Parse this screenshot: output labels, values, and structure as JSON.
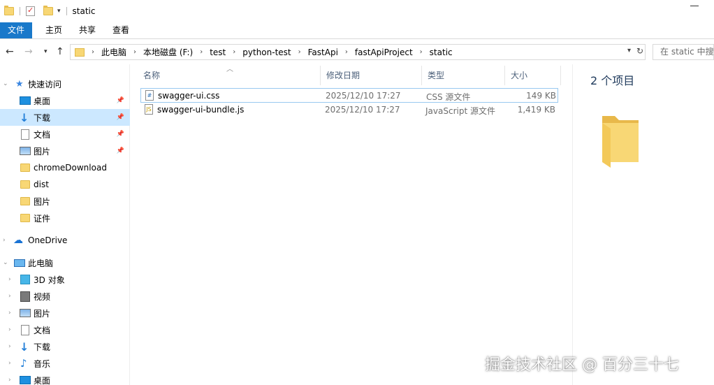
{
  "window": {
    "title": "static"
  },
  "ribbon": {
    "tabs": [
      "文件",
      "主页",
      "共享",
      "查看"
    ]
  },
  "address": {
    "crumbs": [
      "此电脑",
      "本地磁盘 (F:)",
      "test",
      "python-test",
      "FastApi",
      "fastApiProject",
      "static"
    ],
    "search_placeholder": "在 static 中搜索"
  },
  "sidebar": {
    "quick_access": {
      "label": "快速访问",
      "items": [
        {
          "label": "桌面",
          "icon": "desktop-icon",
          "pinned": true
        },
        {
          "label": "下载",
          "icon": "download-icon",
          "pinned": true,
          "selected": true
        },
        {
          "label": "文档",
          "icon": "document-icon",
          "pinned": true
        },
        {
          "label": "图片",
          "icon": "pictures-icon",
          "pinned": true
        },
        {
          "label": "chromeDownload",
          "icon": "folder-icon"
        },
        {
          "label": "dist",
          "icon": "folder-icon"
        },
        {
          "label": "图片",
          "icon": "folder-icon"
        },
        {
          "label": "证件",
          "icon": "folder-icon"
        }
      ]
    },
    "onedrive": {
      "label": "OneDrive"
    },
    "this_pc": {
      "label": "此电脑",
      "items": [
        {
          "label": "3D 对象",
          "icon": "3d-objects-icon"
        },
        {
          "label": "视频",
          "icon": "video-icon"
        },
        {
          "label": "图片",
          "icon": "pictures-icon"
        },
        {
          "label": "文档",
          "icon": "document-icon"
        },
        {
          "label": "下载",
          "icon": "download-icon"
        },
        {
          "label": "音乐",
          "icon": "music-icon"
        },
        {
          "label": "桌面",
          "icon": "desktop-icon"
        }
      ]
    }
  },
  "columns": {
    "name": "名称",
    "modified": "修改日期",
    "type": "类型",
    "size": "大小"
  },
  "files": [
    {
      "name": "swagger-ui.css",
      "modified": "2025/12/10 17:27",
      "type": "CSS 源文件",
      "size": "149 KB",
      "icon": "css-file-icon"
    },
    {
      "name": "swagger-ui-bundle.js",
      "modified": "2025/12/10 17:27",
      "type": "JavaScript 源文件",
      "size": "1,419 KB",
      "icon": "js-file-icon"
    }
  ],
  "details": {
    "count": "2 个项目"
  },
  "watermark": "掘金技术社区 @ 百分三十七"
}
